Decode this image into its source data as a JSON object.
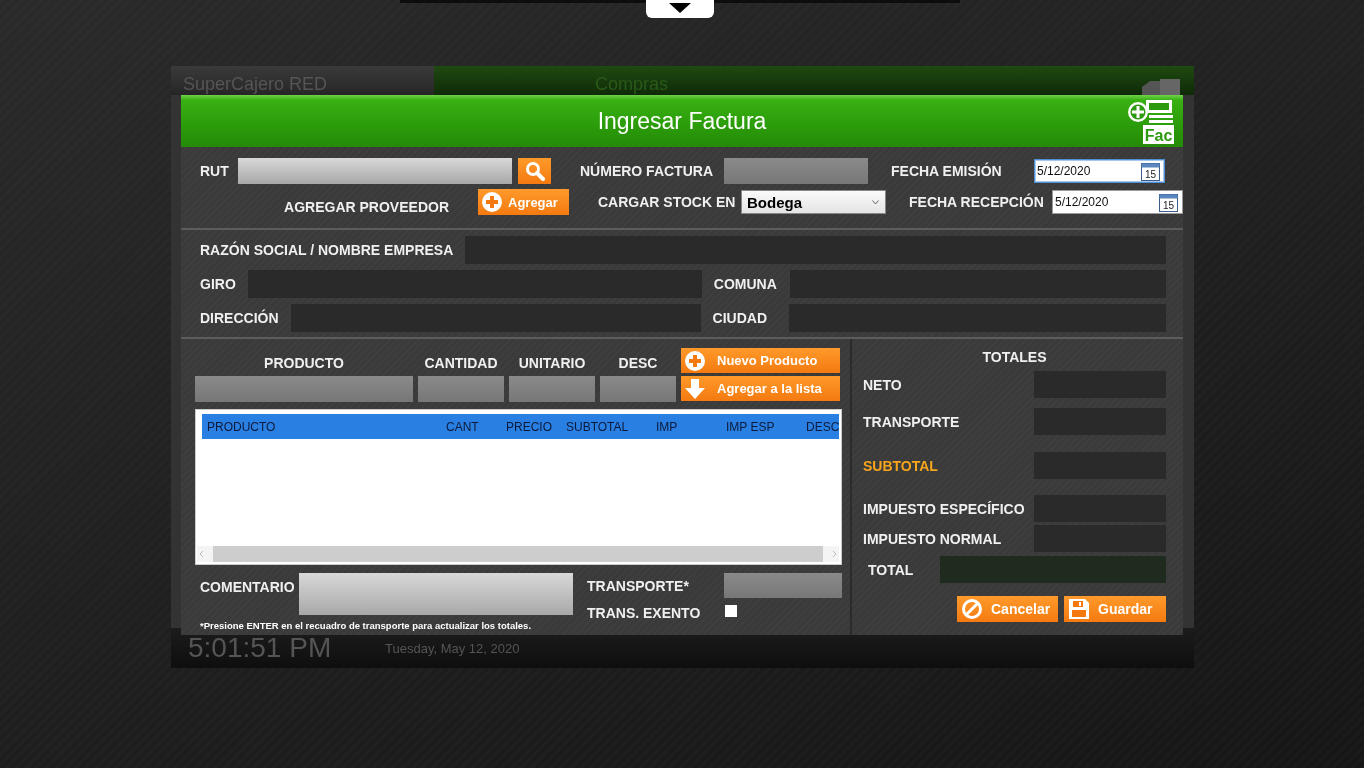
{
  "background_window": {
    "title": "SuperCajero RED",
    "section": "Compras",
    "clock": "5:01:51 PM",
    "date": "Tuesday, May 12, 2020"
  },
  "dialog": {
    "title": "Ingresar Factura",
    "badge_text": "Fac"
  },
  "header_form": {
    "rut": {
      "label": "RUT"
    },
    "add_supplier": {
      "label": "AGREGAR PROVEEDOR",
      "button": "Agregar"
    },
    "invoice_number": {
      "label": "NÚMERO FACTURA"
    },
    "stock": {
      "label": "CARGAR STOCK EN",
      "value": "Bodega"
    },
    "dates": [
      {
        "label": "FECHA EMISIÓN",
        "value": "5/12/2020",
        "focused": true,
        "icon_text": "15"
      },
      {
        "label": "FECHA RECEPCIÓN",
        "value": "5/12/2020",
        "focused": false,
        "icon_text": "15"
      }
    ]
  },
  "supplier": {
    "company": {
      "label": "RAZÓN SOCIAL / NOMBRE EMPRESA"
    },
    "giro": {
      "label": "GIRO"
    },
    "comuna": {
      "label": "COMUNA"
    },
    "address": {
      "label": "DIRECCIÓN"
    },
    "city": {
      "label": "CIUDAD"
    }
  },
  "product_entry": {
    "columns": [
      {
        "label": "PRODUCTO"
      },
      {
        "label": "CANTIDAD"
      },
      {
        "label": "UNITARIO"
      },
      {
        "label": "DESC"
      }
    ],
    "buttons": [
      {
        "label": "Nuevo Producto",
        "kind": "plus"
      },
      {
        "label": "Agregar a la lista",
        "kind": "down"
      }
    ]
  },
  "items_table": {
    "columns": [
      {
        "label": "PRODUCTO"
      },
      {
        "label": "CANT"
      },
      {
        "label": "PRECIO"
      },
      {
        "label": "SUBTOTAL"
      },
      {
        "label": "IMP"
      },
      {
        "label": "IMP ESP"
      },
      {
        "label": "DESC"
      }
    ]
  },
  "comment": {
    "label": "COMENTARIO",
    "note": "*Presione ENTER en el recuadro de transporte para actualizar los totales."
  },
  "transport": {
    "label": "TRANSPORTE*"
  },
  "trans_exempt": {
    "label": "TRANS. EXENTO",
    "checked": false
  },
  "totals": {
    "title": "TOTALES",
    "rows": [
      {
        "label": "NETO",
        "kind": "plain"
      },
      {
        "label": "TRANSPORTE",
        "kind": "plain"
      },
      {
        "label": "SUBTOTAL",
        "kind": "highlight"
      },
      {
        "label": "IMPUESTO ESPECÍFICO",
        "kind": "plain"
      },
      {
        "label": "IMPUESTO NORMAL",
        "kind": "plain"
      },
      {
        "label": "TOTAL",
        "kind": "total"
      }
    ],
    "buttons": [
      {
        "label": "Cancelar",
        "kind": "cancel"
      },
      {
        "label": "Guardar",
        "kind": "save"
      }
    ]
  }
}
